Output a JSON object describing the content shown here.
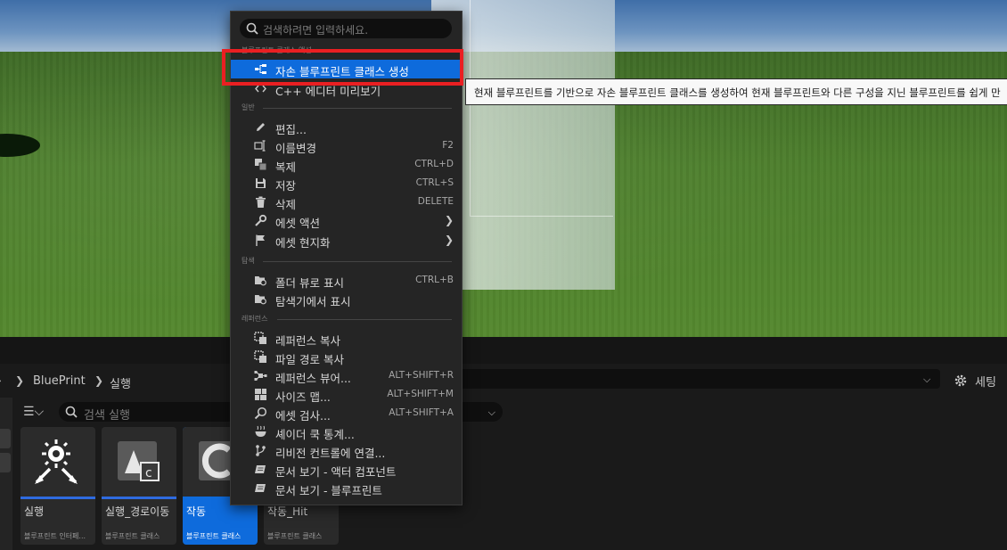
{
  "viewport": {
    "label": "level viewport"
  },
  "context_menu": {
    "search_placeholder": "검색하려면 입력하세요.",
    "sections": {
      "blueprint_class_actions": "블루프린트 클래스 액션",
      "general": "일반",
      "explore": "탐색",
      "references": "레퍼런스"
    },
    "items": {
      "create_child_blueprint": {
        "label": "자손 블루프린트 클래스 생성"
      },
      "edit_cpp": {
        "label": "C++ 에디터 미리보기"
      },
      "edit": {
        "label": "편집..."
      },
      "rename": {
        "label": "이름변경",
        "shortcut": "F2"
      },
      "duplicate": {
        "label": "복제",
        "shortcut": "CTRL+D"
      },
      "save": {
        "label": "저장",
        "shortcut": "CTRL+S"
      },
      "delete": {
        "label": "삭제",
        "shortcut": "DELETE"
      },
      "asset_actions": {
        "label": "에셋 액션"
      },
      "asset_localization": {
        "label": "에셋 현지화"
      },
      "show_in_folder_view": {
        "label": "폴더 뷰로 표시",
        "shortcut": "CTRL+B"
      },
      "show_in_explorer": {
        "label": "탐색기에서 표시"
      },
      "copy_reference": {
        "label": "레퍼런스 복사"
      },
      "copy_file_path": {
        "label": "파일 경로 복사"
      },
      "reference_viewer": {
        "label": "레퍼런스 뷰어...",
        "shortcut": "ALT+SHIFT+R"
      },
      "size_map": {
        "label": "사이즈 맵...",
        "shortcut": "ALT+SHIFT+M"
      },
      "audit_assets": {
        "label": "에셋 검사...",
        "shortcut": "ALT+SHIFT+A"
      },
      "shader_cook_stats": {
        "label": "셰이더 쿡 통계..."
      },
      "connect_source_control": {
        "label": "리비전 컨트롤에 연결..."
      },
      "docs_actor_component": {
        "label": "문서 보기 - 액터 컴포넌트"
      },
      "docs_blueprint": {
        "label": "문서 보기 - 블루프린트"
      }
    }
  },
  "tooltip": {
    "text": "현재 블루프린트를 기반으로 자손 블루프린트 클래스를 생성하여 현재 블루프린트와 다른 구성을 지닌 블루프린트를 쉽게 만"
  },
  "content_browser": {
    "breadcrumb": [
      "BluePrint",
      "실행"
    ],
    "settings_label": "세팅",
    "search_placeholder": "검색 실행",
    "assets": [
      {
        "name": "실행",
        "type": "블루프린트 인터페..."
      },
      {
        "name": "실행_경로이동",
        "type": "블루프린트 클래스"
      },
      {
        "name": "작동",
        "type": "블루프린트 클래스"
      },
      {
        "name": "작동_Hit",
        "type": "블루프린트 클래스"
      }
    ]
  },
  "colors": {
    "accent": "#0e6bdc",
    "highlight_box": "#ea1f22",
    "menu_bg": "#252525",
    "tooltip_bg": "#f8f8f8"
  }
}
